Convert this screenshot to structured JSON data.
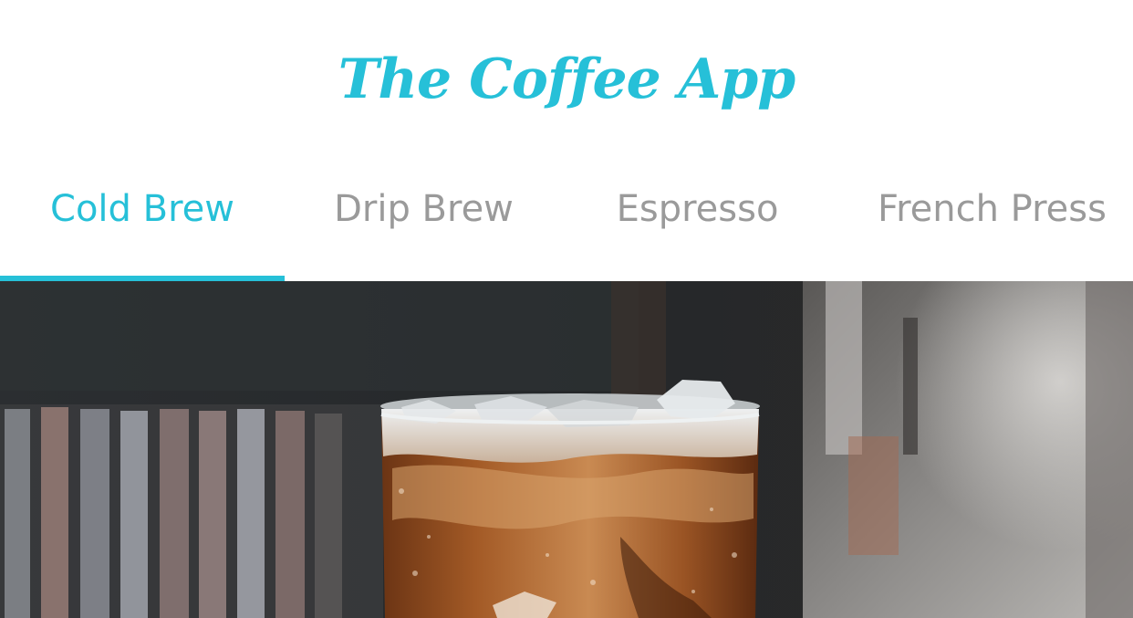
{
  "app": {
    "title": "The Coffee App",
    "accent_color": "#26c0d8",
    "inactive_tab_color": "#9a9a9a"
  },
  "tabs": [
    {
      "label": "Cold Brew",
      "active": true
    },
    {
      "label": "Drip Brew",
      "active": false
    },
    {
      "label": "Espresso",
      "active": false
    },
    {
      "label": "French Press",
      "active": false
    }
  ],
  "hero": {
    "icon": "iced-coffee-photo"
  }
}
